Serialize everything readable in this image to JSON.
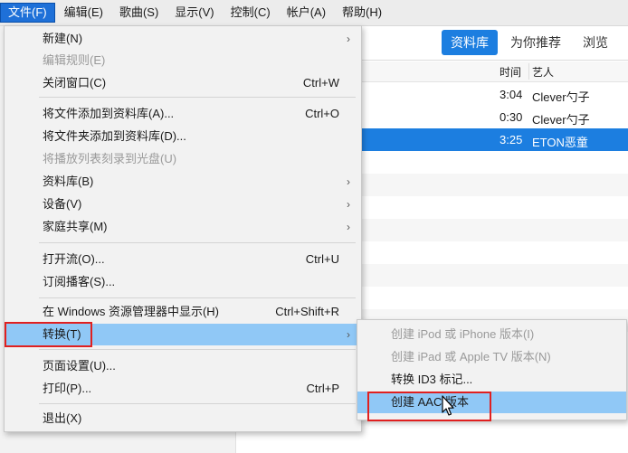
{
  "menubar": [
    "文件(F)",
    "编辑(E)",
    "歌曲(S)",
    "显示(V)",
    "控制(C)",
    "帐户(A)",
    "帮助(H)"
  ],
  "tabs": [
    "资料库",
    "为你推荐",
    "浏览"
  ],
  "table": {
    "headers": {
      "time": "时间",
      "artist": "艺人"
    },
    "rows": [
      {
        "time": "3:04",
        "artist": "Clever勺子"
      },
      {
        "time": "0:30",
        "artist": "Clever勺子"
      },
      {
        "time": "3:25",
        "artist": "ETON恶童"
      }
    ]
  },
  "file_menu": [
    {
      "label": "新建(N)",
      "shortcut": "",
      "submenu": true,
      "disabled": false
    },
    {
      "label": "编辑规则(E)",
      "shortcut": "",
      "submenu": false,
      "disabled": true
    },
    {
      "label": "关闭窗口(C)",
      "shortcut": "Ctrl+W",
      "submenu": false,
      "disabled": false
    },
    {
      "label": "将文件添加到资料库(A)...",
      "shortcut": "Ctrl+O",
      "submenu": false,
      "disabled": false
    },
    {
      "label": "将文件夹添加到资料库(D)...",
      "shortcut": "",
      "submenu": false,
      "disabled": false
    },
    {
      "label": "将播放列表刻录到光盘(U)",
      "shortcut": "",
      "submenu": false,
      "disabled": true
    },
    {
      "label": "资料库(B)",
      "shortcut": "",
      "submenu": true,
      "disabled": false
    },
    {
      "label": "设备(V)",
      "shortcut": "",
      "submenu": true,
      "disabled": false
    },
    {
      "label": "家庭共享(M)",
      "shortcut": "",
      "submenu": true,
      "disabled": false
    },
    {
      "label": "打开流(O)...",
      "shortcut": "Ctrl+U",
      "submenu": false,
      "disabled": false
    },
    {
      "label": "订阅播客(S)...",
      "shortcut": "",
      "submenu": false,
      "disabled": false
    },
    {
      "label": "在 Windows 资源管理器中显示(H)",
      "shortcut": "Ctrl+Shift+R",
      "submenu": false,
      "disabled": false
    },
    {
      "label": "转换(T)",
      "shortcut": "",
      "submenu": true,
      "disabled": false
    },
    {
      "label": "页面设置(U)...",
      "shortcut": "",
      "submenu": false,
      "disabled": false
    },
    {
      "label": "打印(P)...",
      "shortcut": "Ctrl+P",
      "submenu": false,
      "disabled": false
    },
    {
      "label": "退出(X)",
      "shortcut": "",
      "submenu": false,
      "disabled": false
    }
  ],
  "convert_menu": [
    {
      "label": "创建 iPod 或 iPhone 版本(I)",
      "disabled": true
    },
    {
      "label": "创建 iPad 或 Apple TV 版本(N)",
      "disabled": true
    },
    {
      "label": "转换 ID3 标记...",
      "disabled": false
    },
    {
      "label": "创建 AAC 版本",
      "disabled": false
    }
  ],
  "colors": {
    "accent": "#1c7ee0",
    "highlight": "#90c8f6",
    "annotation": "#e02020"
  }
}
